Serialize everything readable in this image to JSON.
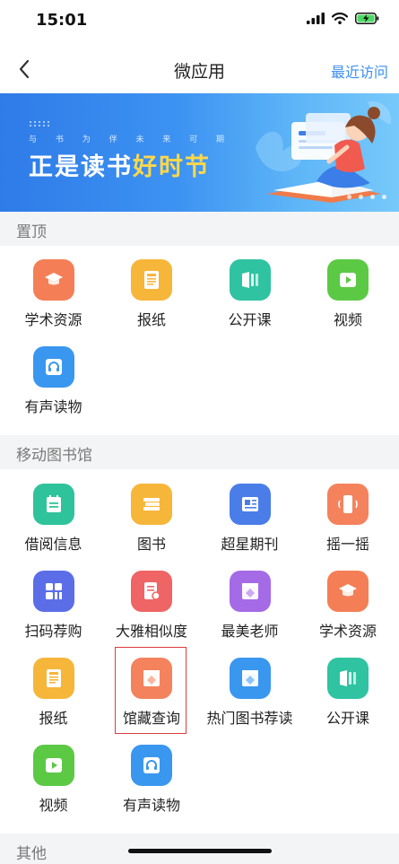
{
  "status": {
    "time": "15:01"
  },
  "nav": {
    "title": "微应用",
    "recent_label": "最近访问"
  },
  "banner": {
    "subtitle": "与 书 为 伴 未 来 可 期",
    "title_plain": "正是读书",
    "title_highlight": "好时节"
  },
  "sections": {
    "pinned": {
      "title": "置顶",
      "items": [
        {
          "label": "学术资源",
          "icon": "mortarboard-icon",
          "color": "#f47f56"
        },
        {
          "label": "报纸",
          "icon": "newspaper-icon",
          "color": "#f6b63a"
        },
        {
          "label": "公开课",
          "icon": "open-book-icon",
          "color": "#2fc3a2"
        },
        {
          "label": "视频",
          "icon": "play-icon",
          "color": "#5cc945"
        },
        {
          "label": "有声读物",
          "icon": "headphones-icon",
          "color": "#3a97f0"
        }
      ]
    },
    "library": {
      "title": "移动图书馆",
      "items": [
        {
          "label": "借阅信息",
          "icon": "calendar-icon",
          "color": "#2fc39b"
        },
        {
          "label": "图书",
          "icon": "books-stack-icon",
          "color": "#f6b63a"
        },
        {
          "label": "超星期刊",
          "icon": "magazine-icon",
          "color": "#4a7de8"
        },
        {
          "label": "摇一摇",
          "icon": "phone-shake-icon",
          "color": "#f4825c"
        },
        {
          "label": "扫码荐购",
          "icon": "qrcode-icon",
          "color": "#5b6ee8"
        },
        {
          "label": "大雅相似度",
          "icon": "document-search-icon",
          "color": "#ef6464"
        },
        {
          "label": "最美老师",
          "icon": "diamond-window-icon",
          "color": "#a56ae6"
        },
        {
          "label": "学术资源",
          "icon": "mortarboard-icon",
          "color": "#f47f56"
        },
        {
          "label": "报纸",
          "icon": "newspaper-icon",
          "color": "#f6b63a"
        },
        {
          "label": "馆藏查询",
          "icon": "diamond-window-icon",
          "color": "#f4825c"
        },
        {
          "label": "热门图书荐读",
          "icon": "diamond-window-icon",
          "color": "#3a97f0"
        },
        {
          "label": "公开课",
          "icon": "open-book-icon",
          "color": "#2fc3a2"
        },
        {
          "label": "视频",
          "icon": "play-icon",
          "color": "#5cc945"
        },
        {
          "label": "有声读物",
          "icon": "headphones-icon",
          "color": "#3a97f0"
        }
      ]
    },
    "other": {
      "title": "其他"
    }
  }
}
